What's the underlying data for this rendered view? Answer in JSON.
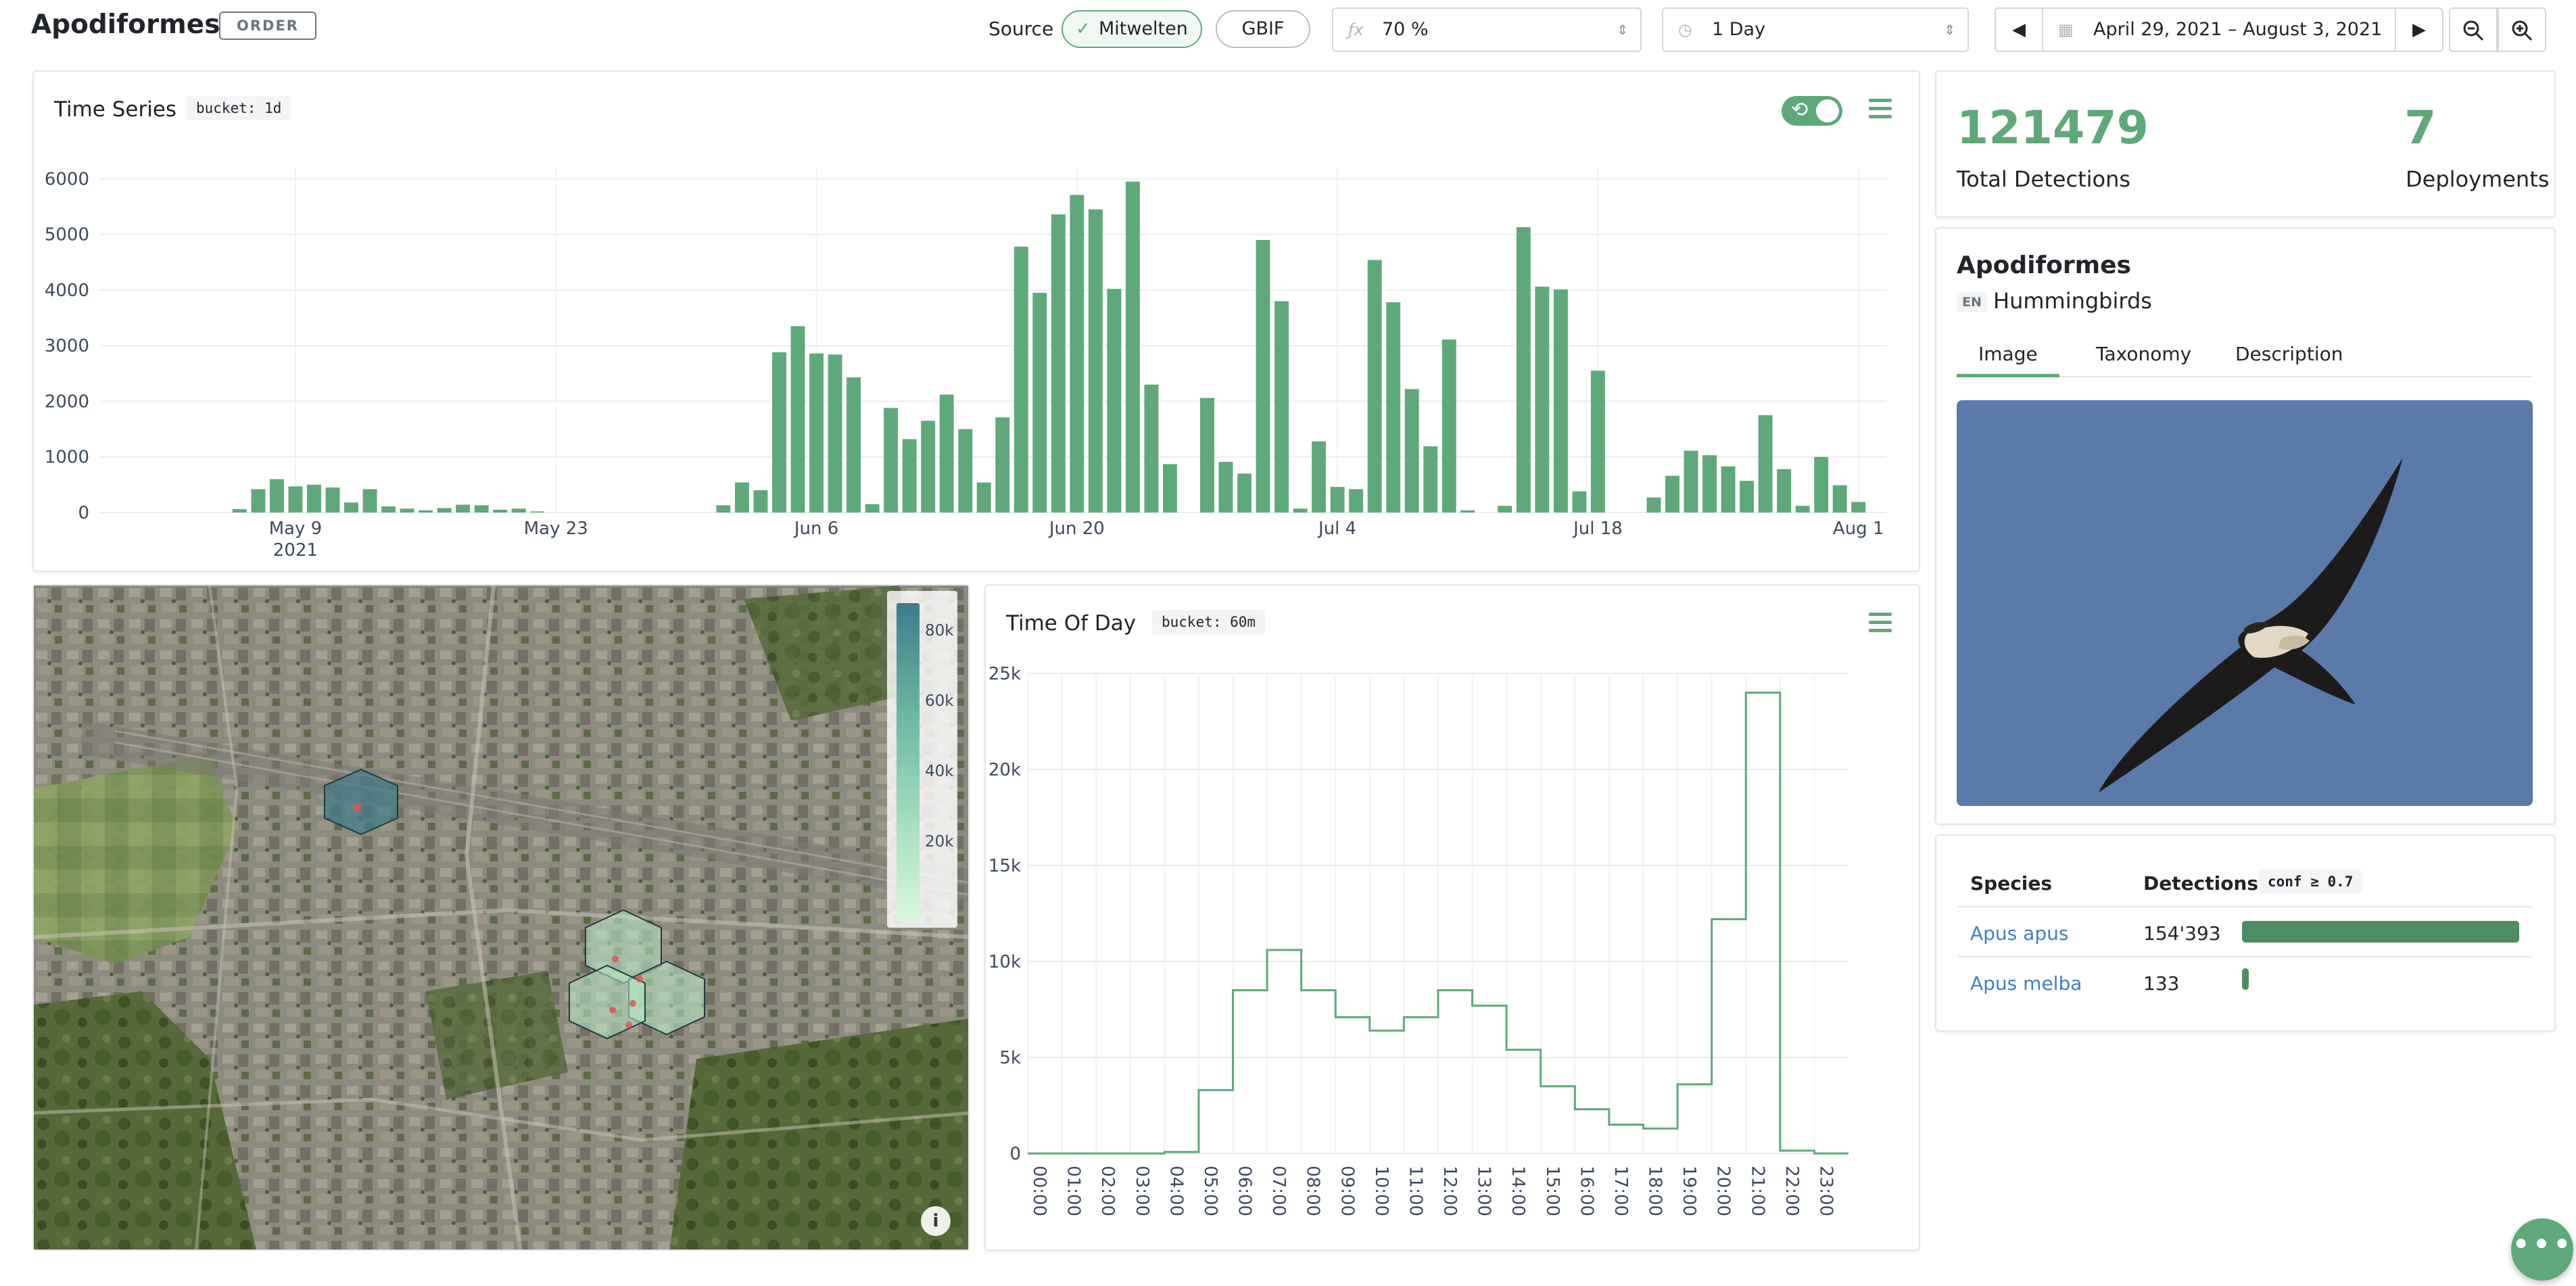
{
  "header": {
    "title": "Apodiformes",
    "rank_badge": "ORDER",
    "source_label": "Source",
    "sources": [
      {
        "label": "Mitwelten",
        "active": true
      },
      {
        "label": "GBIF",
        "active": false
      }
    ],
    "confidence": {
      "icon": "function-icon",
      "value": "70 %"
    },
    "bucket": {
      "icon": "clock-icon",
      "value": "1 Day"
    },
    "date_range": "April 29, 2021 – August 3, 2021"
  },
  "time_series": {
    "title": "Time Series",
    "bucket_badge": "bucket: 1d",
    "realtime_toggle": true
  },
  "time_of_day": {
    "title": "Time Of Day",
    "bucket_badge": "bucket: 60m"
  },
  "stats": {
    "total_detections": "121479",
    "total_detections_label": "Total Detections",
    "deployments": "7",
    "deployments_label": "Deployments"
  },
  "taxon": {
    "name": "Apodiformes",
    "lang": "EN",
    "vernacular": "Hummingbirds",
    "tabs": [
      "Image",
      "Taxonomy",
      "Description"
    ],
    "active_tab": "Image"
  },
  "species_table": {
    "col_species": "Species",
    "col_detections": "Detections",
    "conf_badge": "conf ≥ 0.7",
    "rows": [
      {
        "species": "Apus apus",
        "detections": "154'393",
        "fraction": 1.0
      },
      {
        "species": "Apus melba",
        "detections": "133",
        "fraction": 0.0009
      }
    ]
  },
  "map": {
    "legend_labels": [
      "80k",
      "60k",
      "40k",
      "20k"
    ],
    "legend_range": [
      0,
      90000
    ]
  },
  "colors": {
    "accent": "#5fa87a",
    "bar_dark": "#4c8d62",
    "link": "#3f7fc4"
  },
  "chart_data": [
    {
      "type": "bar",
      "title": "Time Series",
      "xlabel": "",
      "ylabel": "",
      "x_ticks": [
        {
          "label": "May 9",
          "sub": "2021",
          "date": "2021-05-09"
        },
        {
          "label": "May 23",
          "date": "2021-05-23"
        },
        {
          "label": "Jun 6",
          "date": "2021-06-06"
        },
        {
          "label": "Jun 20",
          "date": "2021-06-20"
        },
        {
          "label": "Jul 4",
          "date": "2021-07-04"
        },
        {
          "label": "Jul 18",
          "date": "2021-07-18"
        },
        {
          "label": "Aug 1",
          "date": "2021-08-01"
        }
      ],
      "y_ticks": [
        0,
        1000,
        2000,
        3000,
        4000,
        5000,
        6000
      ],
      "ylim": [
        0,
        6200
      ],
      "xlim": [
        "2021-04-29",
        "2021-08-03"
      ],
      "points": [
        [
          "2021-05-06",
          60
        ],
        [
          "2021-05-07",
          420
        ],
        [
          "2021-05-08",
          600
        ],
        [
          "2021-05-09",
          470
        ],
        [
          "2021-05-10",
          500
        ],
        [
          "2021-05-11",
          450
        ],
        [
          "2021-05-12",
          180
        ],
        [
          "2021-05-13",
          420
        ],
        [
          "2021-05-14",
          110
        ],
        [
          "2021-05-15",
          70
        ],
        [
          "2021-05-16",
          40
        ],
        [
          "2021-05-17",
          80
        ],
        [
          "2021-05-18",
          140
        ],
        [
          "2021-05-19",
          130
        ],
        [
          "2021-05-20",
          50
        ],
        [
          "2021-05-21",
          70
        ],
        [
          "2021-05-22",
          20
        ],
        [
          "2021-06-01",
          130
        ],
        [
          "2021-06-02",
          540
        ],
        [
          "2021-06-03",
          400
        ],
        [
          "2021-06-04",
          2880
        ],
        [
          "2021-06-05",
          3350
        ],
        [
          "2021-06-06",
          2860
        ],
        [
          "2021-06-07",
          2840
        ],
        [
          "2021-06-08",
          2430
        ],
        [
          "2021-06-09",
          150
        ],
        [
          "2021-06-10",
          1880
        ],
        [
          "2021-06-11",
          1320
        ],
        [
          "2021-06-12",
          1650
        ],
        [
          "2021-06-13",
          2120
        ],
        [
          "2021-06-14",
          1500
        ],
        [
          "2021-06-15",
          540
        ],
        [
          "2021-06-16",
          1710
        ],
        [
          "2021-06-17",
          4780
        ],
        [
          "2021-06-18",
          3950
        ],
        [
          "2021-06-19",
          5360
        ],
        [
          "2021-06-20",
          5710
        ],
        [
          "2021-06-21",
          5450
        ],
        [
          "2021-06-22",
          4020
        ],
        [
          "2021-06-23",
          5950
        ],
        [
          "2021-06-24",
          2300
        ],
        [
          "2021-06-25",
          870
        ],
        [
          "2021-06-27",
          2060
        ],
        [
          "2021-06-28",
          910
        ],
        [
          "2021-06-29",
          700
        ],
        [
          "2021-06-30",
          4900
        ],
        [
          "2021-07-01",
          3800
        ],
        [
          "2021-07-02",
          70
        ],
        [
          "2021-07-03",
          1280
        ],
        [
          "2021-07-04",
          460
        ],
        [
          "2021-07-05",
          420
        ],
        [
          "2021-07-06",
          4540
        ],
        [
          "2021-07-07",
          3780
        ],
        [
          "2021-07-08",
          2220
        ],
        [
          "2021-07-09",
          1190
        ],
        [
          "2021-07-10",
          3110
        ],
        [
          "2021-07-11",
          40
        ],
        [
          "2021-07-13",
          120
        ],
        [
          "2021-07-14",
          5130
        ],
        [
          "2021-07-15",
          4060
        ],
        [
          "2021-07-16",
          4010
        ],
        [
          "2021-07-17",
          380
        ],
        [
          "2021-07-18",
          2550
        ],
        [
          "2021-07-21",
          270
        ],
        [
          "2021-07-22",
          660
        ],
        [
          "2021-07-23",
          1110
        ],
        [
          "2021-07-24",
          1030
        ],
        [
          "2021-07-25",
          830
        ],
        [
          "2021-07-26",
          570
        ],
        [
          "2021-07-27",
          1750
        ],
        [
          "2021-07-28",
          780
        ],
        [
          "2021-07-29",
          120
        ],
        [
          "2021-07-30",
          1000
        ],
        [
          "2021-07-31",
          490
        ],
        [
          "2021-08-01",
          190
        ]
      ]
    },
    {
      "type": "line",
      "step": true,
      "title": "Time Of Day",
      "xlabel": "",
      "ylabel": "",
      "categories": [
        "00:00",
        "01:00",
        "02:00",
        "03:00",
        "04:00",
        "05:00",
        "06:00",
        "07:00",
        "08:00",
        "09:00",
        "10:00",
        "11:00",
        "12:00",
        "13:00",
        "14:00",
        "15:00",
        "16:00",
        "17:00",
        "18:00",
        "19:00",
        "20:00",
        "21:00",
        "22:00",
        "23:00"
      ],
      "y_ticks": [
        "0",
        "5k",
        "10k",
        "15k",
        "20k",
        "25k"
      ],
      "ylim": [
        0,
        25000
      ],
      "values": [
        0,
        0,
        0,
        0,
        80,
        3300,
        8500,
        10600,
        8500,
        7100,
        6400,
        7100,
        8500,
        7700,
        5400,
        3500,
        2300,
        1500,
        1300,
        3600,
        12200,
        24000,
        150,
        0
      ]
    }
  ]
}
